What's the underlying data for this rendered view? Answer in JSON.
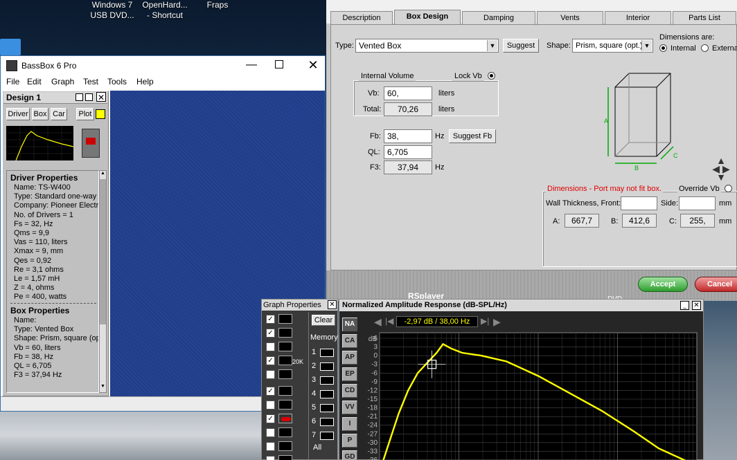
{
  "desktop": {
    "icons": [
      {
        "label1": "Windows 7",
        "label2": "USB DVD..."
      },
      {
        "label1": "OpenHard...",
        "label2": "- Shortcut"
      },
      {
        "label1": "Fraps",
        "label2": ""
      }
    ]
  },
  "main_window": {
    "title": "BassBox 6 Pro",
    "menu": [
      "File",
      "Edit",
      "Graph",
      "Test",
      "Tools",
      "Help"
    ],
    "design_panel": {
      "title": "Design 1",
      "tabs": [
        "Driver",
        "Box",
        "Car"
      ],
      "plot_label": "Plot",
      "plot_color": "#ffff00",
      "driver_heading": "Driver Properties",
      "driver_lines": [
        "Name: TS-W400",
        "Type: Standard one-way d",
        "Company: Pioneer Electro",
        "No. of Drivers = 1",
        "Fs = 32, Hz",
        "Qms = 9,9",
        "Vas = 110, liters",
        "Xmax = 9, mm",
        "Qes = 0,92",
        "Re = 3,1 ohms",
        "Le = 1,57 mH",
        "Z = 4, ohms",
        "Pe = 400, watts"
      ],
      "box_heading": "Box Properties",
      "box_lines": [
        "Name:",
        "Type: Vented Box",
        "Shape: Prism, square (opt",
        "Vb = 60, liters",
        "Fb = 38, Hz",
        "QL = 6,705",
        "F3 = 37,94 Hz"
      ]
    },
    "workspace_color": "#1f3d8a"
  },
  "box_dialog": {
    "tabs": [
      "Description",
      "Box Design",
      "Damping",
      "Vents",
      "Interior",
      "Parts List"
    ],
    "active_tab": "Box Design",
    "type_label": "Type:",
    "type_value": "Vented Box",
    "suggest_label": "Suggest",
    "shape_label": "Shape:",
    "shape_value": "Prism, square (opt.)",
    "dimensions_are_label": "Dimensions are:",
    "internal_label": "Internal",
    "external_label": "External",
    "internal_volume_label": "Internal Volume",
    "lock_vb_label": "Lock Vb",
    "vb_label": "Vb:",
    "vb_value": "60,",
    "vb_unit": "liters",
    "total_label": "Total:",
    "total_value": "70,26",
    "total_unit": "liters",
    "fb_label": "Fb:",
    "fb_value": "38,",
    "fb_unit": "Hz",
    "suggest_fb_label": "Suggest Fb",
    "ql_label": "QL:",
    "ql_value": "6,705",
    "f3_label": "F3:",
    "f3_value": "37,94",
    "f3_unit": "Hz",
    "dim_warning": "Dimensions - Port may not fit box.",
    "override_vb_label": "Override Vb",
    "wall_label": "Wall Thickness, Front:",
    "side_label": "Side:",
    "mm1": "mm",
    "a_label": "A:",
    "a_value": "667,7",
    "b_label": "B:",
    "b_value": "412,6",
    "c_label": "C:",
    "c_value": "255,",
    "mm2": "mm",
    "box_dims": [
      "A",
      "B",
      "C"
    ],
    "accept_label": "Accept",
    "cancel_label": "Cancel"
  },
  "graph_props": {
    "title": "Graph Properties",
    "clear_label": "Clear",
    "memory_label": "Memory",
    "memory_slots": [
      "1",
      "2",
      "3",
      "4",
      "5",
      "6",
      "7"
    ],
    "all_label": "All",
    "twentyk_label": "20K"
  },
  "graph_window": {
    "title": "Normalized Amplitude Response (dB-SPL/Hz)",
    "readout": "-2,97 dB / 38,00 Hz",
    "side_tabs": [
      "NA",
      "CA",
      "AP",
      "EP",
      "CD",
      "VV",
      "I",
      "P",
      "GD"
    ],
    "background_label": "RSplayer",
    "dvd_label": "DVD"
  },
  "chart_data": {
    "type": "line",
    "title": "Normalized Amplitude Response (dB-SPL/Hz)",
    "ylabel": "dB",
    "yticks": [
      "6",
      "3",
      "0",
      "-3",
      "-6",
      "-9",
      "-12",
      "-15",
      "-18",
      "-21",
      "-24",
      "-27",
      "-30",
      "-33",
      "-36"
    ],
    "ylim": [
      -36,
      6
    ],
    "grid": true,
    "series_color": "#ffff00",
    "curve": [
      {
        "x": 0.0,
        "y": -40
      },
      {
        "x": 0.03,
        "y": -30
      },
      {
        "x": 0.06,
        "y": -20
      },
      {
        "x": 0.09,
        "y": -12
      },
      {
        "x": 0.12,
        "y": -6
      },
      {
        "x": 0.15,
        "y": -2.5
      },
      {
        "x": 0.18,
        "y": 1
      },
      {
        "x": 0.2,
        "y": 4
      },
      {
        "x": 0.225,
        "y": 2.5
      },
      {
        "x": 0.26,
        "y": 1
      },
      {
        "x": 0.32,
        "y": 0
      },
      {
        "x": 0.4,
        "y": -2
      },
      {
        "x": 0.5,
        "y": -7
      },
      {
        "x": 0.6,
        "y": -13
      },
      {
        "x": 0.7,
        "y": -19
      },
      {
        "x": 0.8,
        "y": -26
      },
      {
        "x": 0.88,
        "y": -32
      },
      {
        "x": 1.0,
        "y": -38
      }
    ],
    "cursor": {
      "x": 0.165,
      "y": -3
    }
  }
}
